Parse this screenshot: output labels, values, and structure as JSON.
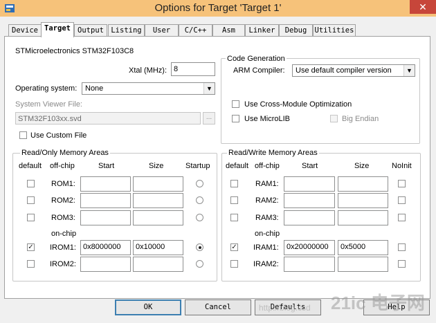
{
  "window": {
    "title": "Options for Target 'Target 1'",
    "close_glyph": "✕"
  },
  "tabs": [
    {
      "label": "Device"
    },
    {
      "label": "Target",
      "active": true
    },
    {
      "label": "Output"
    },
    {
      "label": "Listing"
    },
    {
      "label": "User"
    },
    {
      "label": "C/C++"
    },
    {
      "label": "Asm"
    },
    {
      "label": "Linker"
    },
    {
      "label": "Debug"
    },
    {
      "label": "Utilities"
    }
  ],
  "device": {
    "name": "STMicroelectronics STM32F103C8"
  },
  "xtal": {
    "label": "Xtal (MHz):",
    "value": "8"
  },
  "os": {
    "label": "Operating system:",
    "value": "None"
  },
  "svd": {
    "label": "System Viewer File:",
    "value": "STM32F103xx.svd",
    "browse": "..."
  },
  "custom_file": {
    "label": "Use Custom File",
    "checked": false
  },
  "codegen": {
    "title": "Code Generation",
    "arm_compiler_label": "ARM Compiler:",
    "arm_compiler_value": "Use default compiler version",
    "cross_module": {
      "label": "Use Cross-Module Optimization",
      "checked": false
    },
    "microlib": {
      "label": "Use MicroLIB",
      "checked": false
    },
    "big_endian": {
      "label": "Big Endian",
      "checked": false,
      "disabled": true
    }
  },
  "rom": {
    "title": "Read/Only Memory Areas",
    "headers": {
      "default": "default",
      "offchip": "off-chip",
      "start": "Start",
      "size": "Size",
      "startup": "Startup"
    },
    "onchip_label": "on-chip",
    "rows": [
      {
        "label": "ROM1:",
        "start": "",
        "size": "",
        "default": false,
        "startup": false
      },
      {
        "label": "ROM2:",
        "start": "",
        "size": "",
        "default": false,
        "startup": false
      },
      {
        "label": "ROM3:",
        "start": "",
        "size": "",
        "default": false,
        "startup": false
      },
      {
        "label": "IROM1:",
        "start": "0x8000000",
        "size": "0x10000",
        "default": true,
        "startup": true
      },
      {
        "label": "IROM2:",
        "start": "",
        "size": "",
        "default": false,
        "startup": false
      }
    ]
  },
  "ram": {
    "title": "Read/Write Memory Areas",
    "headers": {
      "default": "default",
      "offchip": "off-chip",
      "start": "Start",
      "size": "Size",
      "noinit": "NoInit"
    },
    "onchip_label": "on-chip",
    "rows": [
      {
        "label": "RAM1:",
        "start": "",
        "size": "",
        "default": false,
        "noinit": false
      },
      {
        "label": "RAM2:",
        "start": "",
        "size": "",
        "default": false,
        "noinit": false
      },
      {
        "label": "RAM3:",
        "start": "",
        "size": "",
        "default": false,
        "noinit": false
      },
      {
        "label": "IRAM1:",
        "start": "0x20000000",
        "size": "0x5000",
        "default": true,
        "noinit": false
      },
      {
        "label": "IRAM2:",
        "start": "",
        "size": "",
        "default": false,
        "noinit": false
      }
    ]
  },
  "buttons": {
    "ok": "OK",
    "cancel": "Cancel",
    "defaults": "Defaults",
    "help": "Help"
  },
  "watermark": {
    "url": "http://blog.csd",
    "logo": "21ic 电子网"
  },
  "colors": {
    "titlebar": "#f6c27a",
    "close": "#c7463a",
    "focus": "#3c7fb1"
  }
}
